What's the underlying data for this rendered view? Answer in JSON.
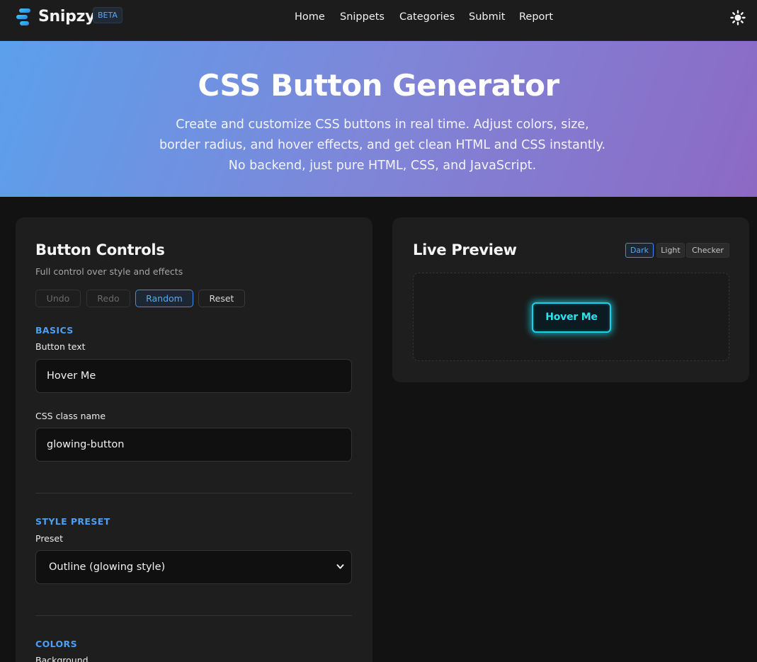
{
  "nav": {
    "brand": "Snipzy",
    "badge": "BETA",
    "links": [
      "Home",
      "Snippets",
      "Categories",
      "Submit",
      "Report"
    ]
  },
  "hero": {
    "title": "CSS Button Generator",
    "description": "Create and customize CSS buttons in real time. Adjust colors, size, border radius, and hover effects, and get clean HTML and CSS instantly. No backend, just pure HTML, CSS, and JavaScript."
  },
  "controls": {
    "title": "Button Controls",
    "subtitle": "Full control over style and effects",
    "actions": {
      "undo": "Undo",
      "redo": "Redo",
      "random": "Random",
      "reset": "Reset"
    },
    "basics": {
      "heading": "BASICS",
      "text_label": "Button text",
      "text_value": "Hover Me",
      "class_label": "CSS class name",
      "class_value": "glowing-button"
    },
    "style": {
      "heading": "STYLE PRESET",
      "preset_label": "Preset",
      "preset_value": "Outline (glowing style)"
    },
    "colors": {
      "heading": "COLORS",
      "background_label": "Background"
    }
  },
  "preview": {
    "title": "Live Preview",
    "bg_options": [
      "Dark",
      "Light",
      "Checker"
    ],
    "selected_bg": "Dark",
    "button_text": "Hover Me"
  },
  "colors": {
    "accent": "#4c9ff3",
    "glow": "#18d3e6",
    "hero_start": "#5ba0ec",
    "hero_end": "#8c69c4",
    "background": "#121212",
    "panel": "#1e1e1e"
  }
}
